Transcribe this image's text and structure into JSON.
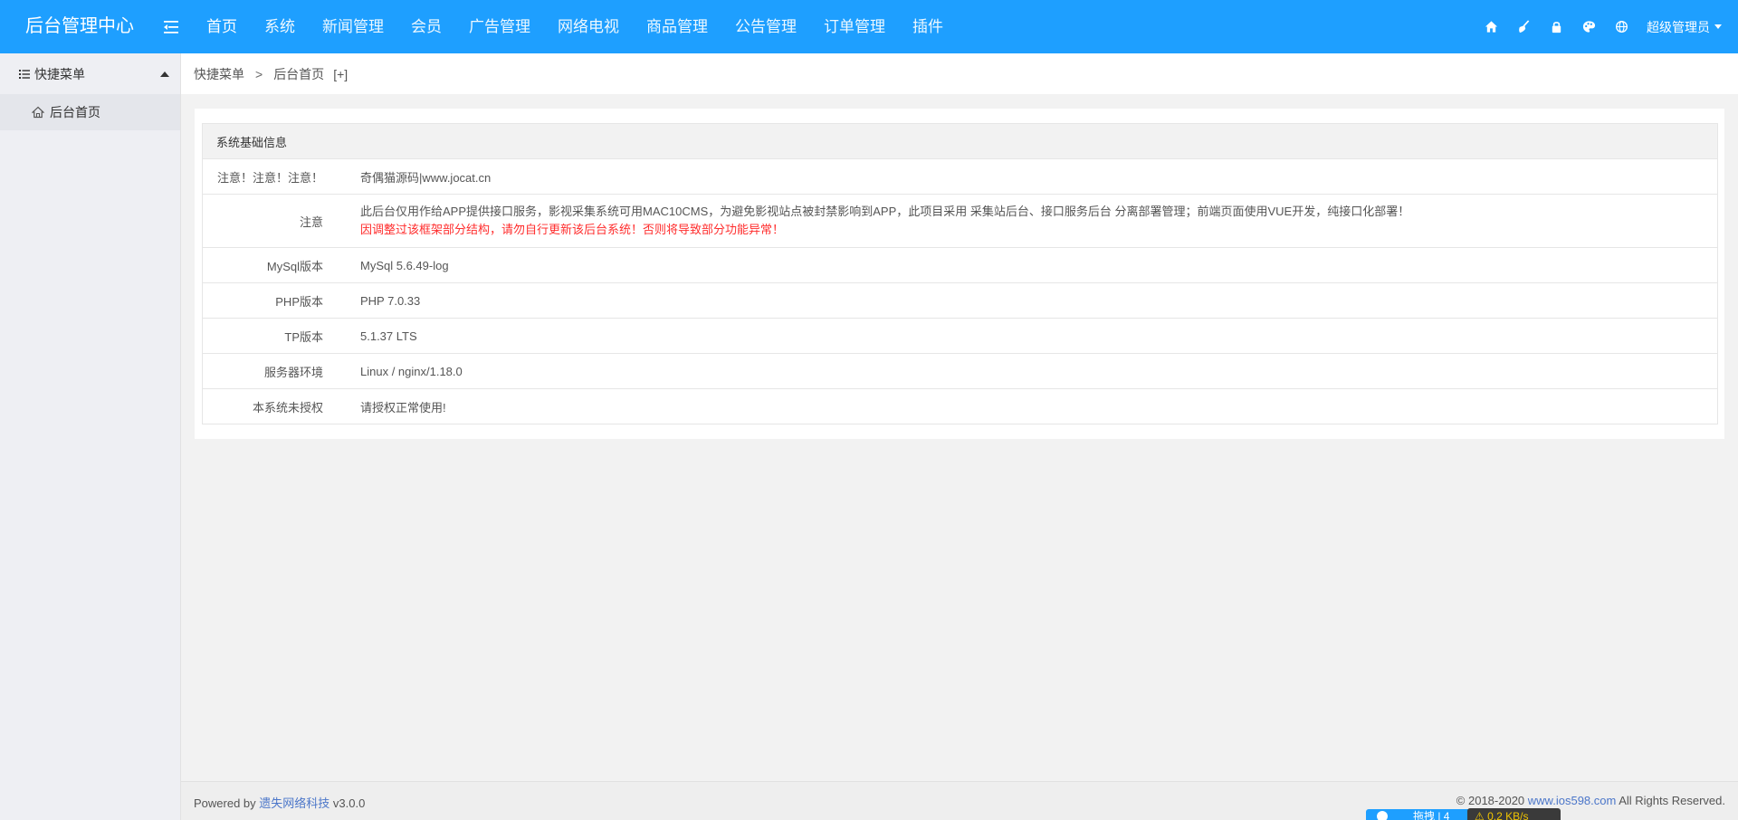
{
  "header": {
    "logo": "后台管理中心",
    "nav": [
      "首页",
      "系统",
      "新闻管理",
      "会员",
      "广告管理",
      "网络电视",
      "商品管理",
      "公告管理",
      "订单管理",
      "插件"
    ],
    "admin_label": "超级管理员",
    "icons": [
      "home-icon",
      "clear-cache-icon",
      "lock-icon",
      "theme-icon",
      "globe-icon"
    ]
  },
  "sidebar": {
    "title": "快捷菜单",
    "items": [
      {
        "label": "后台首页"
      }
    ]
  },
  "breadcrumb": {
    "items": [
      "快捷菜单",
      "后台首页"
    ],
    "separator": ">",
    "add": "[+]"
  },
  "info": {
    "title": "系统基础信息",
    "rows": [
      {
        "label": "注意！注意！注意！",
        "value": "奇偶猫源码|www.jocat.cn"
      },
      {
        "label": "注意",
        "value": "此后台仅用作给APP提供接口服务，影视采集系统可用MAC10CMS，为避免影视站点被封禁影响到APP，此项目采用 采集站后台、接口服务后台 分离部署管理；前端页面使用VUE开发，纯接口化部署！",
        "value2": "因调整过该框架部分结构，请勿自行更新该后台系统！否则将导致部分功能异常！"
      },
      {
        "label": "MySql版本",
        "value": "MySql 5.6.49-log"
      },
      {
        "label": "PHP版本",
        "value": "PHP 7.0.33"
      },
      {
        "label": "TP版本",
        "value": "5.1.37 LTS"
      },
      {
        "label": "服务器环境",
        "value": "Linux / nginx/1.18.0"
      },
      {
        "label": "本系统未授权",
        "value": "请授权正常使用!"
      }
    ]
  },
  "footer": {
    "powered_prefix": "Powered by ",
    "powered_link": "遗失网络科技",
    "version": " v3.0.0",
    "copyright_prefix": "© 2018-2020 ",
    "copyright_link": "www.ios598.com",
    "copyright_suffix": " All Rights Reserved."
  },
  "widgets": {
    "blue_text": "拖拽 | 4",
    "speed_text": "⚠ 0.2 KB/s"
  },
  "colors": {
    "header_bg": "#1e9fff",
    "warning_red": "#ff2d2d",
    "link_blue": "#4b76c9"
  }
}
